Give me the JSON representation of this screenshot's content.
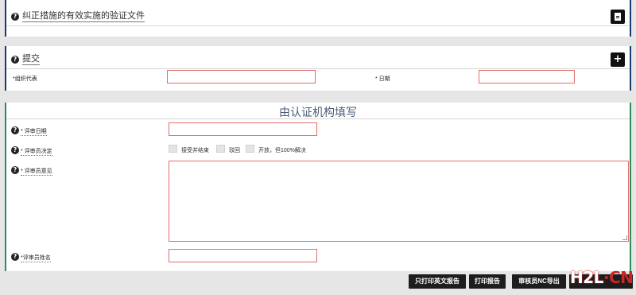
{
  "section1": {
    "title": "纠正措施的有效实施的验证文件"
  },
  "section2": {
    "title": "提交",
    "add_symbol": "+"
  },
  "fields_submit": {
    "org_rep_label": "*组织代表",
    "date_label": "* 日期"
  },
  "auditor_section": {
    "title": "由认证机构填写",
    "review_date_label": "* 评审日期",
    "decision_label": "* 评审员决定",
    "decision_options": [
      "接受并结束",
      "驳回",
      "开放，但100%解决"
    ],
    "opinion_label": "* 评审员意见",
    "name_label": "*评审员姓名"
  },
  "help_symbol": "?",
  "bottom_buttons": [
    "只打印英文报告",
    "打印报告",
    "审核员NC导出"
  ],
  "watermark": {
    "part1": "H2L",
    "part2": "·CN"
  },
  "colors": {
    "frame_blue": "#1a3a6b",
    "frame_green": "#2e8b57",
    "input_border": "#e26c6c",
    "button_bg": "#1d1d1d"
  }
}
